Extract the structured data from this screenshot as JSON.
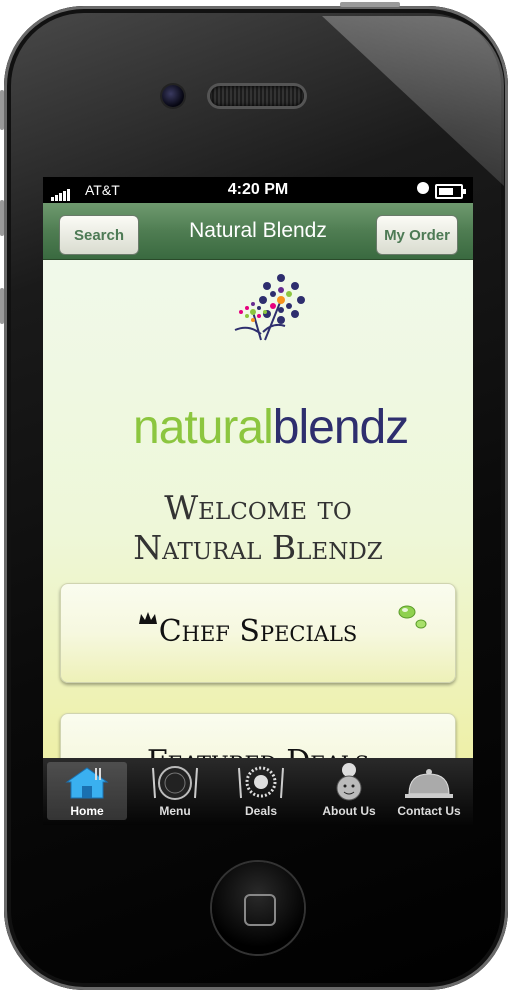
{
  "status": {
    "carrier": "AT&T",
    "time": "4:20 PM"
  },
  "navbar": {
    "title": "Natural Blendz",
    "search_label": "Search",
    "order_label": "My Order"
  },
  "logo": {
    "part1": "natural",
    "part2": "blendz"
  },
  "welcome": {
    "line1": "Welcome to",
    "line2": "Natural Blendz"
  },
  "cards": {
    "chef_specials": "Chef Specials",
    "featured_deals": "Featured Deals"
  },
  "tabs": [
    {
      "label": "Home",
      "icon": "house-icon",
      "active": true
    },
    {
      "label": "Menu",
      "icon": "plate-icon",
      "active": false
    },
    {
      "label": "Deals",
      "icon": "sun-plate-icon",
      "active": false
    },
    {
      "label": "About Us",
      "icon": "chef-icon",
      "active": false
    },
    {
      "label": "Contact Us",
      "icon": "cloche-icon",
      "active": false
    }
  ],
  "colors": {
    "nav_green": "#4f7d52",
    "logo_green": "#8cc63f",
    "logo_navy": "#2e2e6e"
  }
}
